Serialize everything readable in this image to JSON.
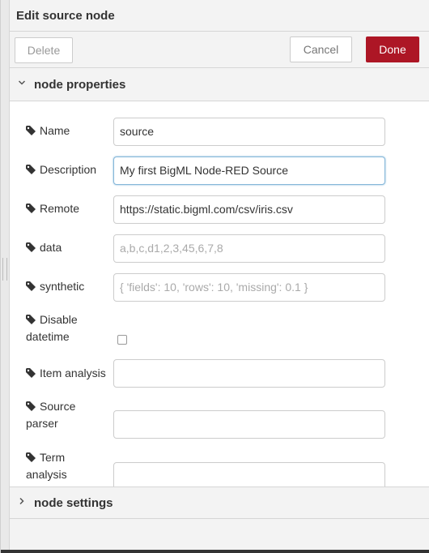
{
  "tray": {
    "title": "Edit source node"
  },
  "toolbar": {
    "delete_label": "Delete",
    "cancel_label": "Cancel",
    "done_label": "Done",
    "done_color": "#ad1625"
  },
  "sections": {
    "properties": "node properties",
    "settings": "node settings"
  },
  "fields": [
    {
      "label_lines": [
        "Name"
      ],
      "value": "source",
      "placeholder": ""
    },
    {
      "label_lines": [
        "Description"
      ],
      "value": "My first BigML Node-RED Source",
      "placeholder": ""
    },
    {
      "label_lines": [
        "Remote"
      ],
      "value": "https://static.bigml.com/csv/iris.csv",
      "placeholder": ""
    },
    {
      "label_lines": [
        "data"
      ],
      "value": "",
      "placeholder": "a,b,c,d1,2,3,45,6,7,8"
    },
    {
      "label_lines": [
        "synthetic"
      ],
      "value": "",
      "placeholder": "{ 'fields': 10, 'rows': 10, 'missing': 0.1 }"
    },
    {
      "label_lines": [
        "Disable",
        "datetime"
      ],
      "checked": false
    },
    {
      "label_lines": [
        "Item analysis"
      ],
      "value": "",
      "placeholder": ""
    },
    {
      "label_lines": [
        "Source",
        "parser"
      ],
      "value": "",
      "placeholder": ""
    },
    {
      "label_lines": [
        "Term",
        "analysis"
      ],
      "value": "",
      "placeholder": ""
    }
  ],
  "icons": {
    "label_icon": "tag-icon",
    "expanded": "chevron-down-icon",
    "collapsed": "chevron-right-icon"
  }
}
